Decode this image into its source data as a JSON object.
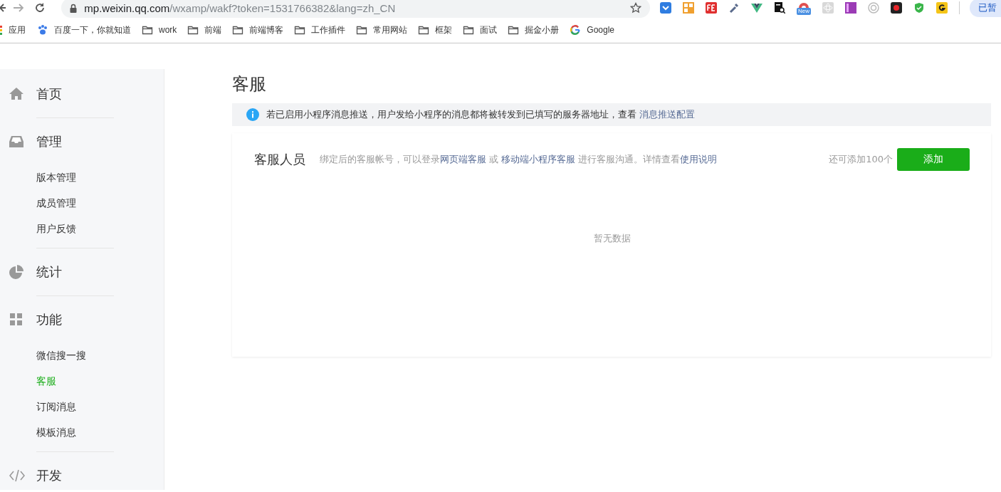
{
  "browser": {
    "url_host": "mp.weixin.qq.com",
    "url_path": "/wxamp/wakf?token=1531766382&lang=zh_CN",
    "extensions": [
      {
        "kind": "pocket",
        "color": "#2f7de1"
      },
      {
        "kind": "qr",
        "color": "#f0a030"
      },
      {
        "kind": "fe",
        "color": "#e03030"
      },
      {
        "kind": "dropper",
        "color": "#5a6b8c"
      },
      {
        "kind": "vue",
        "color": "#41b883"
      },
      {
        "kind": "doc-search",
        "color": "#111111"
      },
      {
        "kind": "new",
        "color": "#e05050",
        "badge": "New"
      },
      {
        "kind": "atom",
        "color": "#d8d8d8"
      },
      {
        "kind": "rp",
        "color": "#9b3bb5"
      },
      {
        "kind": "ring",
        "color": "#bbbbbb"
      },
      {
        "kind": "record",
        "color": "#222222"
      },
      {
        "kind": "shield",
        "color": "#3ab54a"
      },
      {
        "kind": "g",
        "color": "#f5c518"
      }
    ],
    "profile": "已暂"
  },
  "bookmarks": [
    {
      "kind": "apps",
      "label": "应用"
    },
    {
      "kind": "paw",
      "label": "百度一下，你就知道"
    },
    {
      "kind": "folder",
      "label": "work"
    },
    {
      "kind": "folder",
      "label": "前端"
    },
    {
      "kind": "folder",
      "label": "前端博客"
    },
    {
      "kind": "folder",
      "label": "工作插件"
    },
    {
      "kind": "folder",
      "label": "常用网站"
    },
    {
      "kind": "folder",
      "label": "框架"
    },
    {
      "kind": "folder",
      "label": "面试"
    },
    {
      "kind": "folder",
      "label": "掘金小册"
    },
    {
      "kind": "google",
      "label": "Google"
    }
  ],
  "sidebar": {
    "sections": [
      {
        "kind": "home",
        "label": "首页"
      },
      {
        "kind": "inbox",
        "label": "管理",
        "children": [
          {
            "label": "版本管理",
            "selected": false
          },
          {
            "label": "成员管理",
            "selected": false
          },
          {
            "label": "用户反馈",
            "selected": false
          }
        ]
      },
      {
        "kind": "pie",
        "label": "统计"
      },
      {
        "kind": "grid",
        "label": "功能",
        "children": [
          {
            "label": "微信搜一搜",
            "selected": false
          },
          {
            "label": "客服",
            "selected": true
          },
          {
            "label": "订阅消息",
            "selected": false
          },
          {
            "label": "模板消息",
            "selected": false
          }
        ]
      },
      {
        "kind": "code",
        "label": "开发"
      }
    ]
  },
  "page": {
    "title": "客服",
    "notice": [
      {
        "kind": "text",
        "text": "若已启用小程序消息推送，用户发给小程序的消息都将被转发到已填写的服务器地址，查看 "
      },
      {
        "kind": "link",
        "text": "消息推送配置"
      }
    ],
    "card": {
      "title": "客服人员",
      "description": [
        {
          "kind": "text",
          "text": "绑定后的客服帐号，可以登录"
        },
        {
          "kind": "link",
          "text": "网页端客服"
        },
        {
          "kind": "text",
          "text": " 或 "
        },
        {
          "kind": "link",
          "text": "移动端小程序客服"
        },
        {
          "kind": "text",
          "text": " 进行客服沟通。详情查看"
        },
        {
          "kind": "link",
          "text": "使用说明"
        }
      ],
      "remaining": "还可添加100个",
      "add_button": "添加",
      "empty": "暂无数据"
    }
  }
}
